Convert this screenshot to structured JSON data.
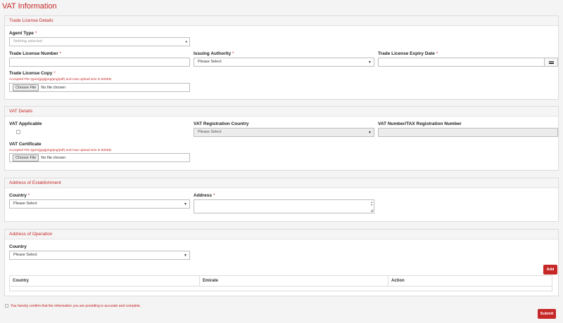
{
  "page_title": "VAT Information",
  "trade_license": {
    "heading": "Trade License Details",
    "agent_type_label": "Agent Type",
    "agent_type_value": "Nothing selected",
    "number_label": "Trade License Number",
    "issuing_authority_label": "Issuing Authority",
    "issuing_authority_value": "Please Select",
    "expiry_label": "Trade License Expiry Date",
    "copy_label": "Trade License Copy",
    "copy_hint": "Accepted File types(jpg/jpeg/png/pdf) and max upload size is 500KB",
    "choose_file": "Choose File",
    "no_file": "No file chosen"
  },
  "vat_details": {
    "heading": "VAT Details",
    "applicable_label": "VAT Applicable",
    "country_label": "VAT Registration Country",
    "country_value": "Please Select",
    "number_label": "VAT Number/TAX Registration Number",
    "certificate_label": "VAT Certificate",
    "certificate_hint": "Accepted File types(jpg/jpeg/png/pdf) and max upload size is 500KB",
    "choose_file": "Choose File",
    "no_file": "No file chosen"
  },
  "establishment": {
    "heading": "Address of Establishment",
    "country_label": "Country",
    "country_value": "Please Select",
    "address_label": "Address"
  },
  "operation": {
    "heading": "Address of Operation",
    "country_label": "Country",
    "country_value": "Please Select",
    "add_label": "Add",
    "columns": [
      "Country",
      "Emirate",
      "Action"
    ]
  },
  "confirm_text": "You hereby confirm that the information you are providing is accurate and complete.",
  "submit_label": "Submit",
  "required_mark": "*",
  "colors": {
    "accent": "#c62828",
    "panel_head": "#f5f5f5",
    "background": "#f4f4f4"
  }
}
